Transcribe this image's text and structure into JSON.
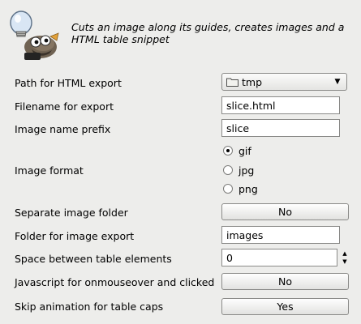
{
  "header": {
    "description": "Cuts an image along its guides, creates images and a HTML table snippet",
    "icon": "gimp-wilber-lightbulb-icon"
  },
  "fields": {
    "path": {
      "label": "Path for HTML export",
      "value": "tmp",
      "icon": "folder-icon"
    },
    "filename": {
      "label": "Filename for export",
      "value": "slice.html"
    },
    "prefix": {
      "label": "Image name prefix",
      "value": "slice"
    },
    "format": {
      "label": "Image format",
      "options": [
        {
          "label": "gif",
          "selected": true
        },
        {
          "label": "jpg",
          "selected": false
        },
        {
          "label": "png",
          "selected": false
        }
      ]
    },
    "separate_folder": {
      "label": "Separate image folder",
      "value": "No"
    },
    "image_folder": {
      "label": "Folder for image export",
      "value": "images"
    },
    "spacing": {
      "label": "Space between table elements",
      "value": "0"
    },
    "javascript": {
      "label": "Javascript for onmouseover and clicked",
      "value": "No"
    },
    "skip_animation": {
      "label": "Skip animation for table caps",
      "value": "Yes"
    }
  }
}
